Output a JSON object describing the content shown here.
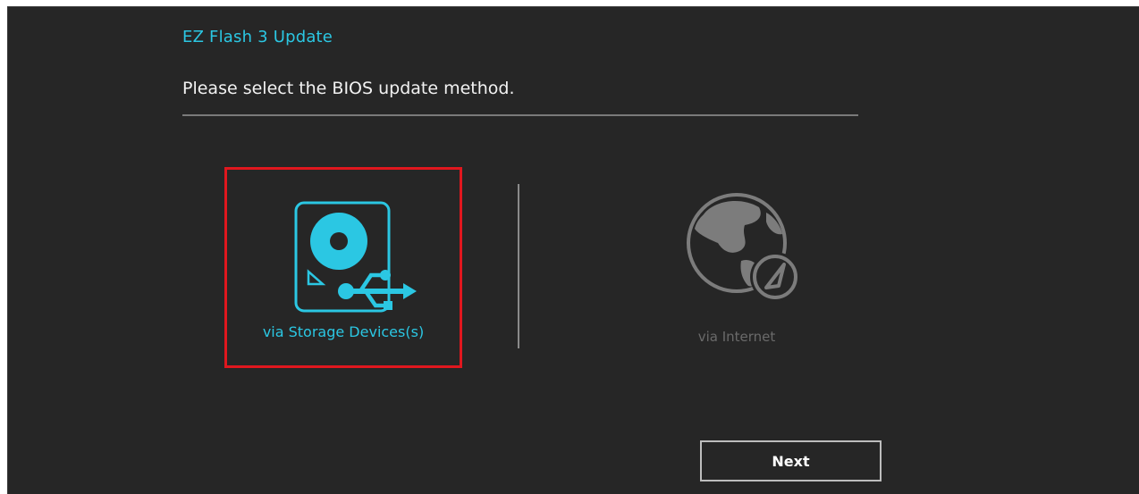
{
  "window": {
    "title": "EZ Flash 3 Update",
    "prompt": "Please select the BIOS update method."
  },
  "options": [
    {
      "label": "via Storage Devices(s)",
      "icon": "storage-usb-icon",
      "selected": true
    },
    {
      "label": "via Internet",
      "icon": "globe-compass-icon",
      "selected": false
    }
  ],
  "footer": {
    "next_label": "Next"
  },
  "colors": {
    "background": "#262626",
    "accent": "#2bc7e3",
    "selection_border": "#e0171e",
    "disabled": "#6a6a6a"
  }
}
